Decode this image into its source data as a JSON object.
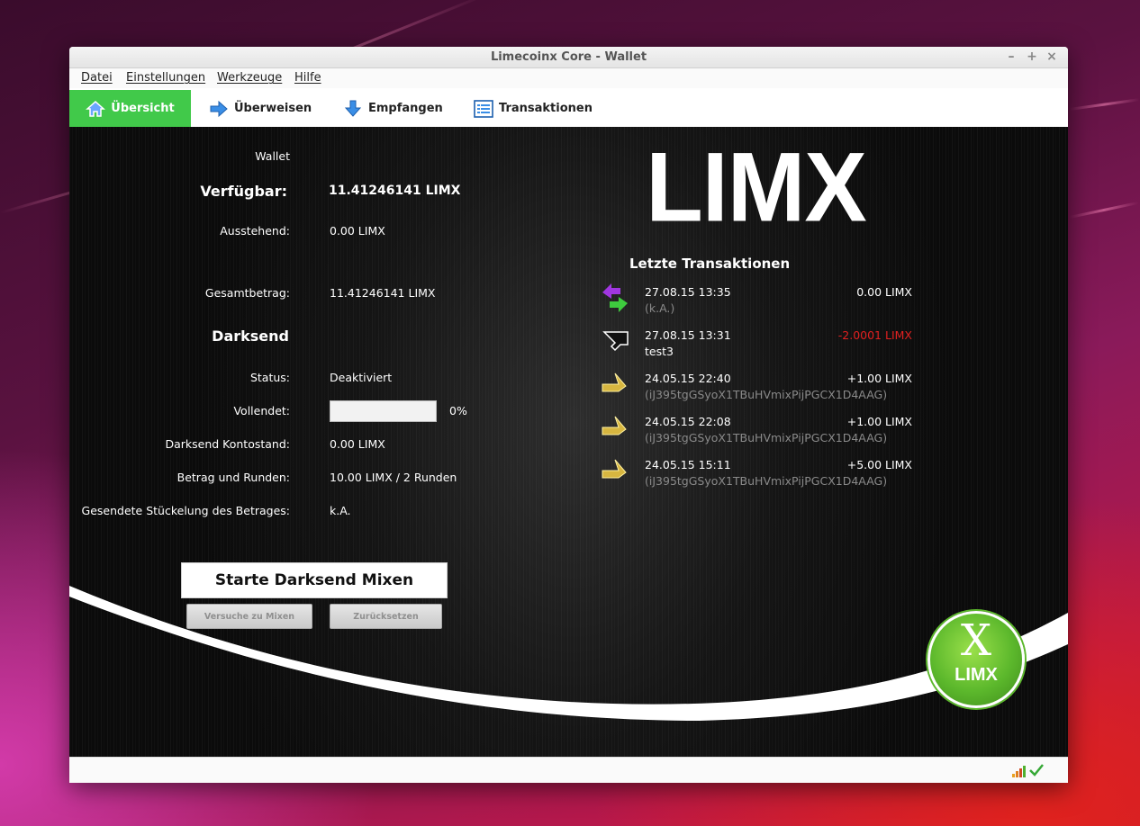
{
  "window": {
    "title": "Limecoinx Core - Wallet",
    "controls": [
      "–",
      "+",
      "×"
    ]
  },
  "menu": [
    "Datei",
    "Einstellungen",
    "Werkzeuge",
    "Hilfe"
  ],
  "tabs": [
    {
      "label": "Übersicht",
      "icon": "home-icon",
      "active": true
    },
    {
      "label": "Überweisen",
      "icon": "send-arrow-icon",
      "active": false
    },
    {
      "label": "Empfangen",
      "icon": "receive-arrow-icon",
      "active": false
    },
    {
      "label": "Transaktionen",
      "icon": "list-icon",
      "active": false
    }
  ],
  "wallet": {
    "heading": "Wallet",
    "available_label": "Verfügbar:",
    "available_value": "11.41246141 LIMX",
    "pending_label": "Ausstehend:",
    "pending_value": "0.00 LIMX",
    "total_label": "Gesamtbetrag:",
    "total_value": "11.41246141 LIMX"
  },
  "darksend": {
    "heading": "Darksend",
    "status_label": "Status:",
    "status_value": "Deaktiviert",
    "completed_label": "Vollendet:",
    "completed_percent": "0%",
    "completed_fraction": 0,
    "balance_label": "Darksend Kontostand:",
    "balance_value": "0.00 LIMX",
    "amount_rounds_label": "Betrag und Runden:",
    "amount_rounds_value": "10.00 LIMX / 2 Runden",
    "denom_label": "Gesendete Stückelung des Betrages:",
    "denom_value": "k.A.",
    "start_button": "Starte Darksend Mixen",
    "try_button": "Versuche zu Mixen",
    "reset_button": "Zurücksetzen"
  },
  "logo": {
    "text": "LIMX",
    "badge_letter": "X",
    "badge_text": "LIMX"
  },
  "recent": {
    "heading": "Letzte Transaktionen",
    "items": [
      {
        "date": "27.08.15 13:35",
        "secondary": "(k.A.)",
        "secondary_style": "address",
        "amount": "0.00 LIMX",
        "amount_color": "#ffffff",
        "icon": "mixing-arrows-icon"
      },
      {
        "date": "27.08.15 13:31",
        "secondary": "test3",
        "secondary_style": "label",
        "amount": "-2.0001 LIMX",
        "amount_color": "#e02020",
        "icon": "sent-arrow-icon"
      },
      {
        "date": "24.05.15 22:40",
        "secondary": "(iJ395tgGSyoX1TBuHVmixPijPGCX1D4AAG)",
        "secondary_style": "address",
        "amount": "+1.00 LIMX",
        "amount_color": "#ffffff",
        "icon": "received-arrow-icon"
      },
      {
        "date": "24.05.15 22:08",
        "secondary": "(iJ395tgGSyoX1TBuHVmixPijPGCX1D4AAG)",
        "secondary_style": "address",
        "amount": "+1.00 LIMX",
        "amount_color": "#ffffff",
        "icon": "received-arrow-icon"
      },
      {
        "date": "24.05.15 15:11",
        "secondary": "(iJ395tgGSyoX1TBuHVmixPijPGCX1D4AAG)",
        "secondary_style": "address",
        "amount": "+5.00 LIMX",
        "amount_color": "#ffffff",
        "icon": "received-arrow-icon"
      }
    ]
  },
  "statusbar": {
    "icons": [
      "signal-bars-icon",
      "sync-check-icon"
    ]
  },
  "colors": {
    "accent": "#41c94a",
    "negative": "#e02020",
    "address": "#8a8a8a"
  }
}
